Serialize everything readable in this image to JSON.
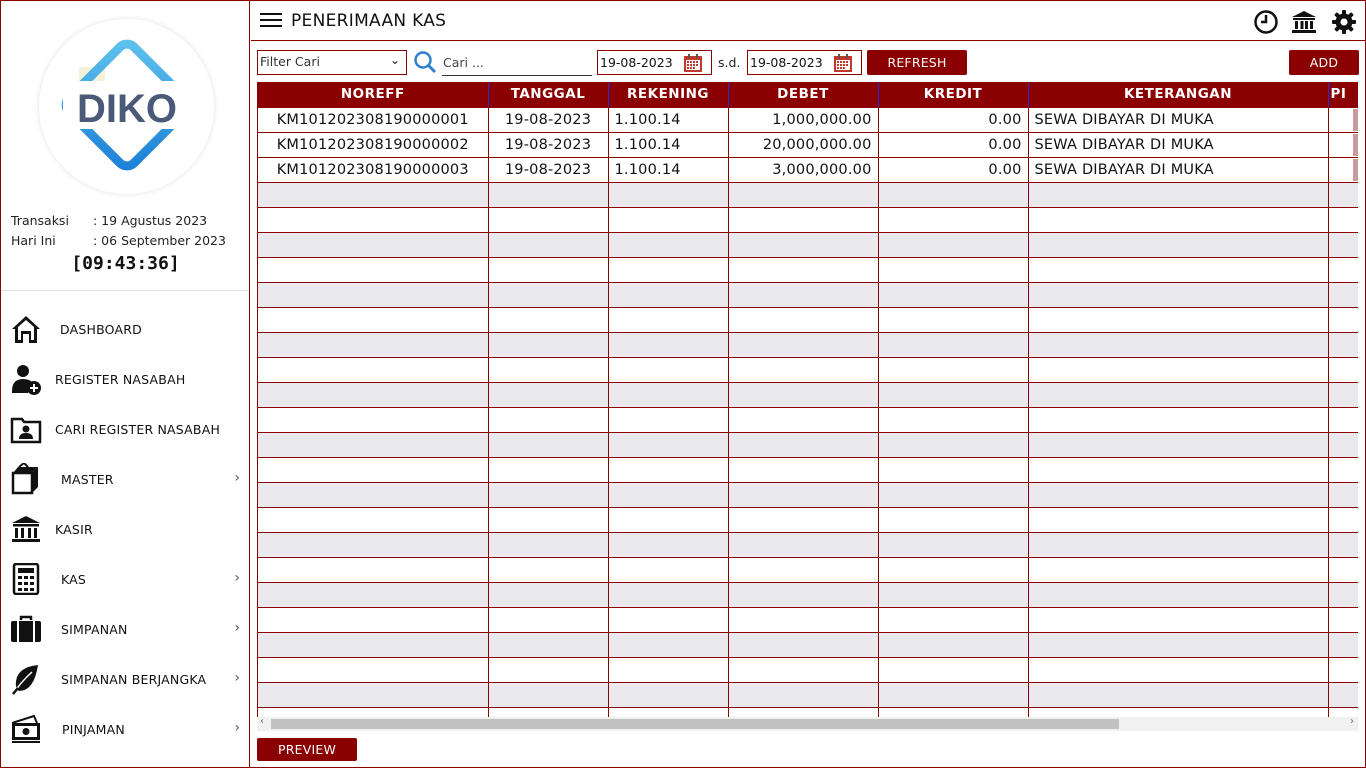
{
  "app": {
    "logo_text": "DIKO",
    "accent": "#8b0000"
  },
  "sidebar": {
    "transaksi_label": "Transaksi",
    "transaksi_value": ": 19 Agustus 2023",
    "hari_ini_label": "Hari Ini",
    "hari_ini_value": ": 06 September 2023",
    "clock": "[09:43:36]",
    "items": [
      {
        "label": "DASHBOARD",
        "icon": "home-icon",
        "submenu": false
      },
      {
        "label": "REGISTER NASABAH",
        "icon": "add-user-icon",
        "submenu": false
      },
      {
        "label": "CARI REGISTER NASABAH",
        "icon": "user-folder-icon",
        "submenu": false
      },
      {
        "label": "MASTER",
        "icon": "box-icon",
        "submenu": true
      },
      {
        "label": "KASIR",
        "icon": "bank-icon",
        "submenu": false
      },
      {
        "label": "KAS",
        "icon": "calculator-icon",
        "submenu": true
      },
      {
        "label": "SIMPANAN",
        "icon": "briefcase-icon",
        "submenu": true
      },
      {
        "label": "SIMPANAN BERJANGKA",
        "icon": "leaf-icon",
        "submenu": true
      },
      {
        "label": "PINJAMAN",
        "icon": "money-icon",
        "submenu": true
      }
    ],
    "chevron": "›"
  },
  "header": {
    "title": "PENERIMAAN KAS"
  },
  "toolbar": {
    "filter_value": "Filter Cari",
    "search_placeholder": "Cari ...",
    "date_from": "19-08-2023",
    "sd_label": "s.d.",
    "date_to": "19-08-2023",
    "refresh_label": "REFRESH",
    "add_label": "ADD",
    "preview_label": "PREVIEW"
  },
  "table": {
    "columns": [
      "NOREFF",
      "TANGGAL",
      "REKENING",
      "DEBET",
      "KREDIT",
      "KETERANGAN",
      "PI"
    ],
    "rows": [
      [
        "KM101202308190000001",
        "19-08-2023",
        "1.100.14",
        "1,000,000.00",
        "0.00",
        "SEWA DIBAYAR DI MUKA"
      ],
      [
        "KM101202308190000002",
        "19-08-2023",
        "1.100.14",
        "20,000,000.00",
        "0.00",
        "SEWA DIBAYAR DI MUKA"
      ],
      [
        "KM101202308190000003",
        "19-08-2023",
        "1.100.14",
        "3,000,000.00",
        "0.00",
        "SEWA DIBAYAR DI MUKA"
      ]
    ]
  },
  "scroll": {
    "left_arrow": "‹",
    "right_arrow": "›"
  }
}
